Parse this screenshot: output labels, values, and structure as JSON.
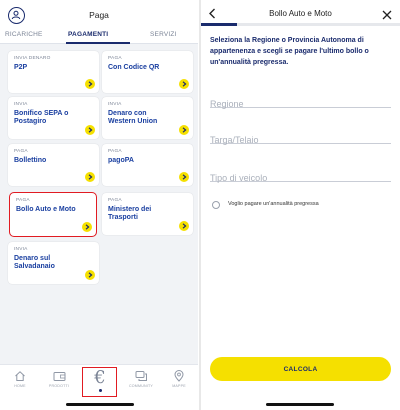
{
  "left": {
    "title": "Paga",
    "tabs": [
      {
        "label": "RICARICHE",
        "active": false
      },
      {
        "label": "PAGAMENTI",
        "active": true
      },
      {
        "label": "SERVIZI",
        "active": false
      }
    ],
    "cards": [
      {
        "category": "INVIA DENARO",
        "title": "P2P"
      },
      {
        "category": "PAGA",
        "title": "Con Codice QR"
      },
      {
        "category": "INVIA",
        "title": "Bonifico SEPA o Postagiro"
      },
      {
        "category": "INVIA",
        "title": "Denaro con Western Union"
      },
      {
        "category": "PAGA",
        "title": "Bollettino"
      },
      {
        "category": "PAGA",
        "title": "pagoPA"
      },
      {
        "category": "PAGA",
        "title": "Bollo Auto e Moto",
        "selected": true
      },
      {
        "category": "PAGA",
        "title": "Ministero dei Trasporti"
      },
      {
        "category": "INVIA",
        "title": "Denaro sul Salvadanaio"
      }
    ],
    "nav": [
      {
        "label": "HOME",
        "icon": "home-icon"
      },
      {
        "label": "PRODOTTI",
        "icon": "wallet-icon"
      },
      {
        "label": "",
        "icon": "euro-icon",
        "active": true
      },
      {
        "label": "COMMUNITY",
        "icon": "community-icon"
      },
      {
        "label": "MAPPE",
        "icon": "map-pin-icon"
      }
    ],
    "colors": {
      "accent": "#1a2b6d",
      "yellow": "#f5e000",
      "highlight": "#e11b22"
    }
  },
  "right": {
    "title": "Bollo Auto e Moto",
    "progress": 0.18,
    "intro": "Seleziona la Regione o Provincia Autonoma di appartenenza e scegli se pagare l'ultimo bollo o un'annualità pregressa.",
    "fields": {
      "regione": {
        "placeholder": "Regione",
        "value": ""
      },
      "targa": {
        "placeholder": "Targa/Telaio",
        "value": ""
      },
      "veicolo": {
        "placeholder": "Tipo di veicolo",
        "value": ""
      }
    },
    "radio_label": "Voglio pagare un'annualità pregressa",
    "button_label": "CALCOLA"
  }
}
